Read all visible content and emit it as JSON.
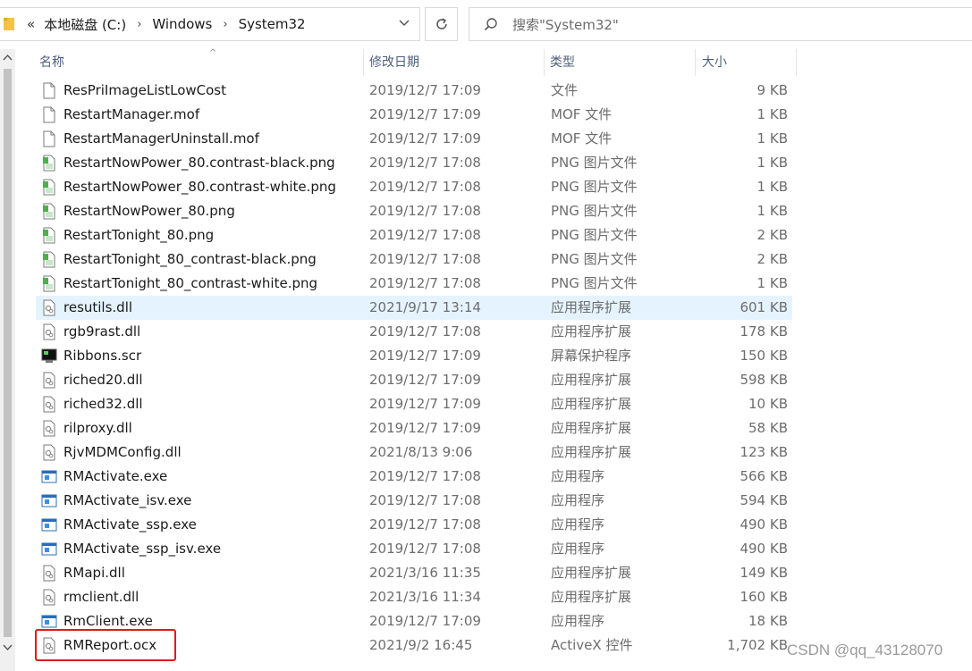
{
  "address": {
    "overflow": "«",
    "crumbs": [
      "本地磁盘 (C:)",
      "Windows",
      "System32"
    ]
  },
  "search": {
    "placeholder": "搜索\"System32\""
  },
  "columns": {
    "name": "名称",
    "date": "修改日期",
    "type": "类型",
    "size": "大小"
  },
  "files": [
    {
      "name": "ResPriImageListLowCost",
      "date": "2019/12/7 17:09",
      "type": "文件",
      "size": "9 KB",
      "icon": "file-icon"
    },
    {
      "name": "RestartManager.mof",
      "date": "2019/12/7 17:09",
      "type": "MOF 文件",
      "size": "1 KB",
      "icon": "file-icon"
    },
    {
      "name": "RestartManagerUninstall.mof",
      "date": "2019/12/7 17:09",
      "type": "MOF 文件",
      "size": "1 KB",
      "icon": "file-icon"
    },
    {
      "name": "RestartNowPower_80.contrast-black.png",
      "date": "2019/12/7 17:08",
      "type": "PNG 图片文件",
      "size": "1 KB",
      "icon": "image-file-icon"
    },
    {
      "name": "RestartNowPower_80.contrast-white.png",
      "date": "2019/12/7 17:08",
      "type": "PNG 图片文件",
      "size": "1 KB",
      "icon": "image-file-icon"
    },
    {
      "name": "RestartNowPower_80.png",
      "date": "2019/12/7 17:08",
      "type": "PNG 图片文件",
      "size": "1 KB",
      "icon": "image-file-icon"
    },
    {
      "name": "RestartTonight_80.png",
      "date": "2019/12/7 17:08",
      "type": "PNG 图片文件",
      "size": "2 KB",
      "icon": "image-file-icon"
    },
    {
      "name": "RestartTonight_80_contrast-black.png",
      "date": "2019/12/7 17:08",
      "type": "PNG 图片文件",
      "size": "2 KB",
      "icon": "image-file-icon"
    },
    {
      "name": "RestartTonight_80_contrast-white.png",
      "date": "2019/12/7 17:08",
      "type": "PNG 图片文件",
      "size": "1 KB",
      "icon": "image-file-icon"
    },
    {
      "name": "resutils.dll",
      "date": "2021/9/17 13:14",
      "type": "应用程序扩展",
      "size": "601 KB",
      "icon": "dll-file-icon",
      "hover": true
    },
    {
      "name": "rgb9rast.dll",
      "date": "2019/12/7 17:08",
      "type": "应用程序扩展",
      "size": "178 KB",
      "icon": "dll-file-icon"
    },
    {
      "name": "Ribbons.scr",
      "date": "2019/12/7 17:09",
      "type": "屏幕保护程序",
      "size": "150 KB",
      "icon": "screensaver-icon"
    },
    {
      "name": "riched20.dll",
      "date": "2019/12/7 17:09",
      "type": "应用程序扩展",
      "size": "598 KB",
      "icon": "dll-file-icon"
    },
    {
      "name": "riched32.dll",
      "date": "2019/12/7 17:09",
      "type": "应用程序扩展",
      "size": "10 KB",
      "icon": "dll-file-icon"
    },
    {
      "name": "rilproxy.dll",
      "date": "2019/12/7 17:09",
      "type": "应用程序扩展",
      "size": "58 KB",
      "icon": "dll-file-icon"
    },
    {
      "name": "RjvMDMConfig.dll",
      "date": "2021/8/13 9:06",
      "type": "应用程序扩展",
      "size": "123 KB",
      "icon": "dll-file-icon"
    },
    {
      "name": "RMActivate.exe",
      "date": "2019/12/7 17:08",
      "type": "应用程序",
      "size": "566 KB",
      "icon": "exe-file-icon"
    },
    {
      "name": "RMActivate_isv.exe",
      "date": "2019/12/7 17:08",
      "type": "应用程序",
      "size": "594 KB",
      "icon": "exe-file-icon"
    },
    {
      "name": "RMActivate_ssp.exe",
      "date": "2019/12/7 17:08",
      "type": "应用程序",
      "size": "490 KB",
      "icon": "exe-file-icon"
    },
    {
      "name": "RMActivate_ssp_isv.exe",
      "date": "2019/12/7 17:08",
      "type": "应用程序",
      "size": "490 KB",
      "icon": "exe-file-icon"
    },
    {
      "name": "RMapi.dll",
      "date": "2021/3/16 11:35",
      "type": "应用程序扩展",
      "size": "149 KB",
      "icon": "dll-file-icon"
    },
    {
      "name": "rmclient.dll",
      "date": "2021/3/16 11:34",
      "type": "应用程序扩展",
      "size": "160 KB",
      "icon": "dll-file-icon"
    },
    {
      "name": "RmClient.exe",
      "date": "2019/12/7 17:09",
      "type": "应用程序",
      "size": "18 KB",
      "icon": "exe-file-icon"
    },
    {
      "name": "RMReport.ocx",
      "date": "2021/9/2 16:45",
      "type": "ActiveX 控件",
      "size": "1,702 KB",
      "icon": "dll-file-icon",
      "highlighted": true
    }
  ],
  "watermark": "CSDN @qq_43128070",
  "colors": {
    "hover": "#e5f3ff",
    "highlight_border": "#e0191c",
    "header_text": "#4c607a"
  }
}
